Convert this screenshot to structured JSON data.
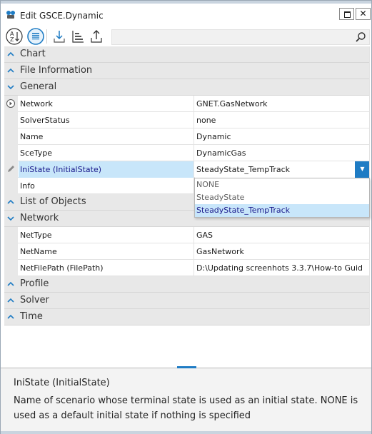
{
  "window": {
    "title": "Edit GSCE.Dynamic",
    "close_glyph": "✕"
  },
  "toolbar": {
    "sort_icon": "sort-az-icon",
    "categorize_icon": "categorize-icon",
    "import_icon": "import-icon",
    "tree_icon": "tree-icon",
    "export_icon": "export-icon",
    "search_value": "",
    "accent_color": "#1f7cc4"
  },
  "categories": {
    "chart": "Chart",
    "file_information": "File Information",
    "general": "General",
    "list_of_objects": "List of Objects",
    "network": "Network",
    "profile": "Profile",
    "solver": "Solver",
    "time": "Time"
  },
  "general_props": [
    {
      "name": "Network",
      "value": "GNET.GasNetwork"
    },
    {
      "name": "SolverStatus",
      "value": "none"
    },
    {
      "name": "Name",
      "value": "Dynamic"
    },
    {
      "name": "SceType",
      "value": "DynamicGas"
    },
    {
      "name": "IniState (InitialState)",
      "value": "SteadyState_TempTrack"
    },
    {
      "name": "Info",
      "value": ""
    }
  ],
  "dropdown": {
    "options": [
      "NONE",
      "SteadyState",
      "SteadyState_TempTrack"
    ],
    "selected": "SteadyState_TempTrack",
    "arrow": "▼"
  },
  "network_props": [
    {
      "name": "NetType",
      "value": "GAS"
    },
    {
      "name": "NetName",
      "value": "GasNetwork"
    },
    {
      "name": "NetFilePath (FilePath)",
      "value": "D:\\Updating screenhots 3.3.7\\How-to Guid"
    }
  ],
  "help": {
    "title": "IniState (InitialState)",
    "description": "Name of scenario whose terminal state is used as an initial state. NONE is used as a default initial state if nothing is specified"
  }
}
